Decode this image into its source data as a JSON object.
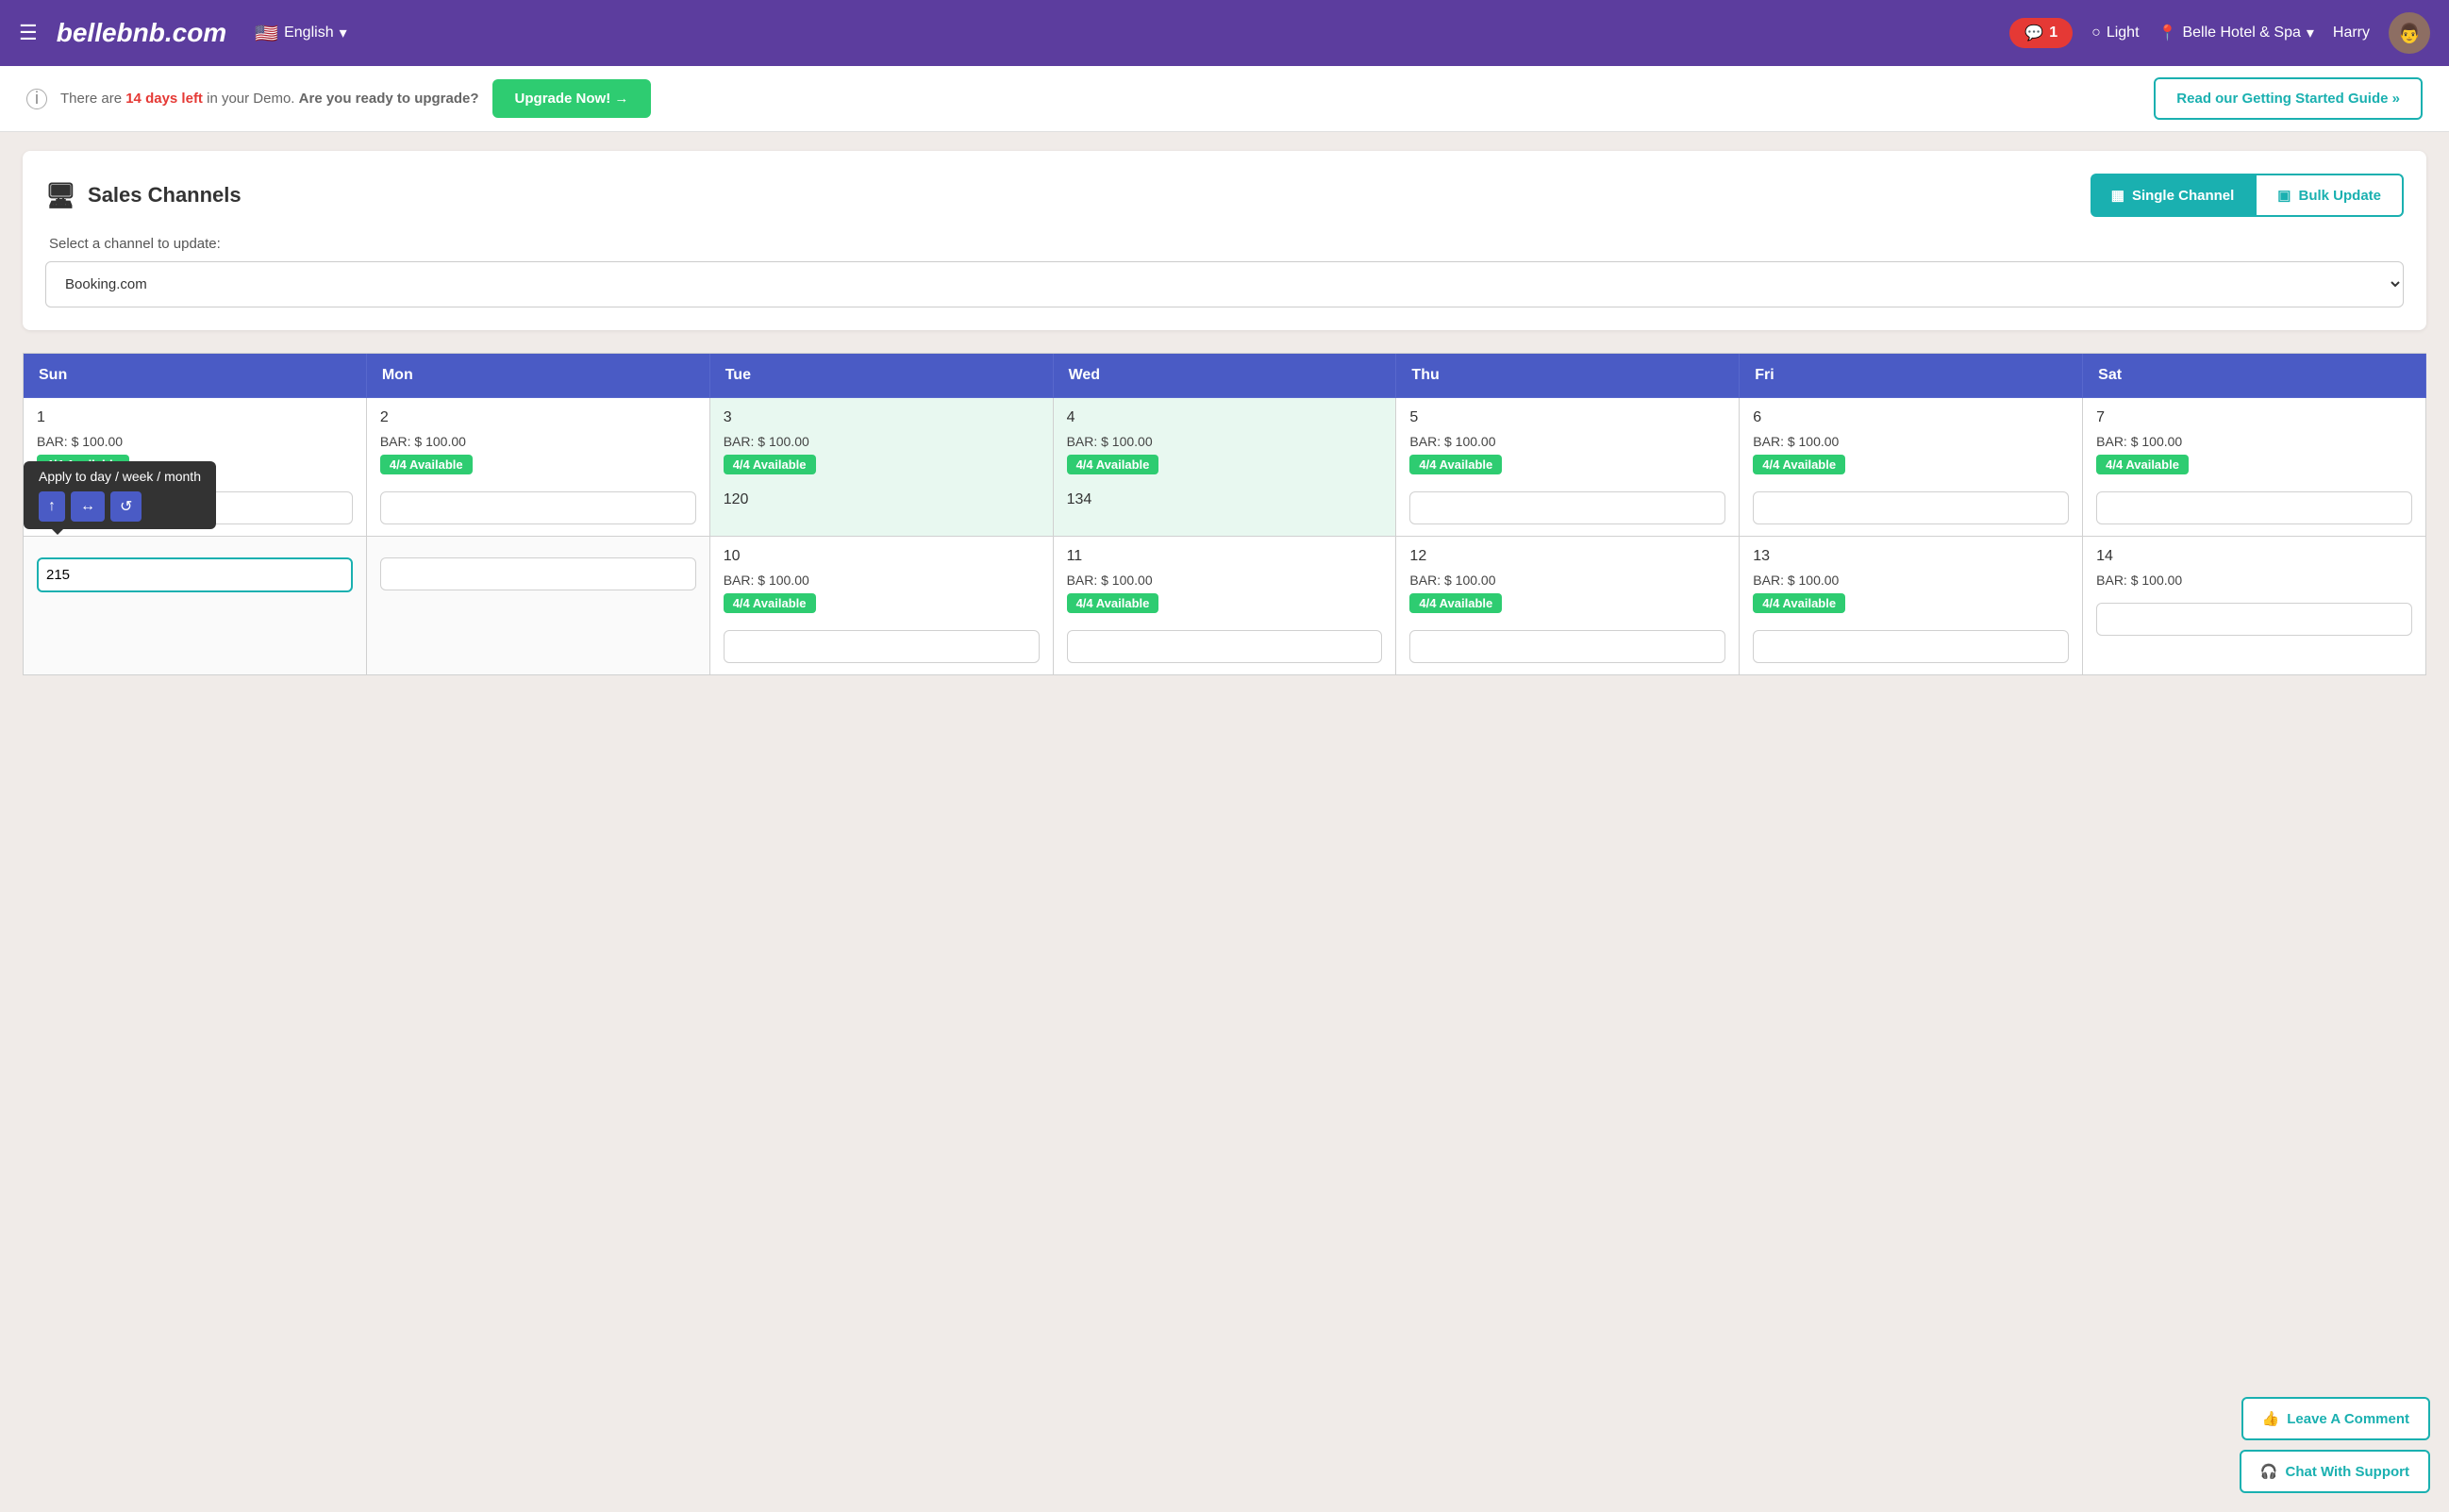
{
  "header": {
    "menu_icon": "☰",
    "logo": "bellebnb.com",
    "language": "English",
    "flag": "🇺🇸",
    "chat_badge": "1",
    "light_label": "Light",
    "hotel_name": "Belle Hotel & Spa",
    "user_name": "Harry",
    "avatar_emoji": "👨"
  },
  "banner": {
    "info_text": "There are",
    "days_left": "14 days left",
    "info_text2": "in your Demo.",
    "bold_text": "Are you ready to upgrade?",
    "upgrade_label": "Upgrade Now! →",
    "guide_label": "Read our Getting Started Guide »"
  },
  "page": {
    "title": "Sales Channels",
    "title_icon": "🖥",
    "single_channel_label": "Single Channel",
    "bulk_update_label": "Bulk Update",
    "select_label": "Select a channel to update:",
    "channel_value": "Booking.com"
  },
  "calendar": {
    "days": [
      "Sun",
      "Mon",
      "Tue",
      "Wed",
      "Thu",
      "Fri",
      "Sat"
    ],
    "rows": [
      [
        {
          "day": 1,
          "bar": "BAR: $ 100.00",
          "avail": "4/4 Available",
          "number": "",
          "input": ""
        },
        {
          "day": 2,
          "bar": "BAR: $ 100.00",
          "avail": "4/4 Available",
          "number": "",
          "input": ""
        },
        {
          "day": 3,
          "bar": "BAR: $ 100.00",
          "avail": "4/4 Available",
          "number": "120",
          "input": "",
          "highlighted": true
        },
        {
          "day": 4,
          "bar": "BAR: $ 100.00",
          "avail": "4/4 Available",
          "number": "134",
          "input": "",
          "highlighted": true
        },
        {
          "day": 5,
          "bar": "BAR: $ 100.00",
          "avail": "4/4 Available",
          "number": "",
          "input": ""
        },
        {
          "day": 6,
          "bar": "BAR: $ 100.00",
          "avail": "4/4 Available",
          "number": "",
          "input": ""
        },
        {
          "day": 7,
          "bar": "BAR: $ 100.00",
          "avail": "4/4 Available",
          "number": "",
          "input": ""
        }
      ],
      [
        {
          "day": "",
          "bar": "",
          "avail": "",
          "number": "",
          "input": "",
          "empty": true,
          "show_tooltip": true
        },
        {
          "day": "",
          "bar": "",
          "avail": "",
          "number": "",
          "input": "",
          "empty": true
        },
        {
          "day": 10,
          "bar": "BAR: $ 100.00",
          "avail": "4/4 Available",
          "number": "",
          "input": ""
        },
        {
          "day": 11,
          "bar": "BAR: $ 100.00",
          "avail": "4/4 Available",
          "number": "",
          "input": ""
        },
        {
          "day": 12,
          "bar": "BAR: $ 100.00",
          "avail": "4/4 Available",
          "number": "",
          "input": ""
        },
        {
          "day": 13,
          "bar": "BAR: $ 100.00",
          "avail": "4/4 Available",
          "number": "",
          "input": ""
        },
        {
          "day": 14,
          "bar": "BAR: $ 100.00",
          "avail": "",
          "number": "",
          "input": ""
        }
      ]
    ],
    "tooltip": {
      "label": "Apply to day / week / month",
      "btn1": "↑",
      "btn2": "↔",
      "btn3": "↺",
      "input_value": "215"
    }
  },
  "bottom_actions": {
    "leave_comment": "Leave A Comment",
    "chat_support": "Chat With Support"
  }
}
